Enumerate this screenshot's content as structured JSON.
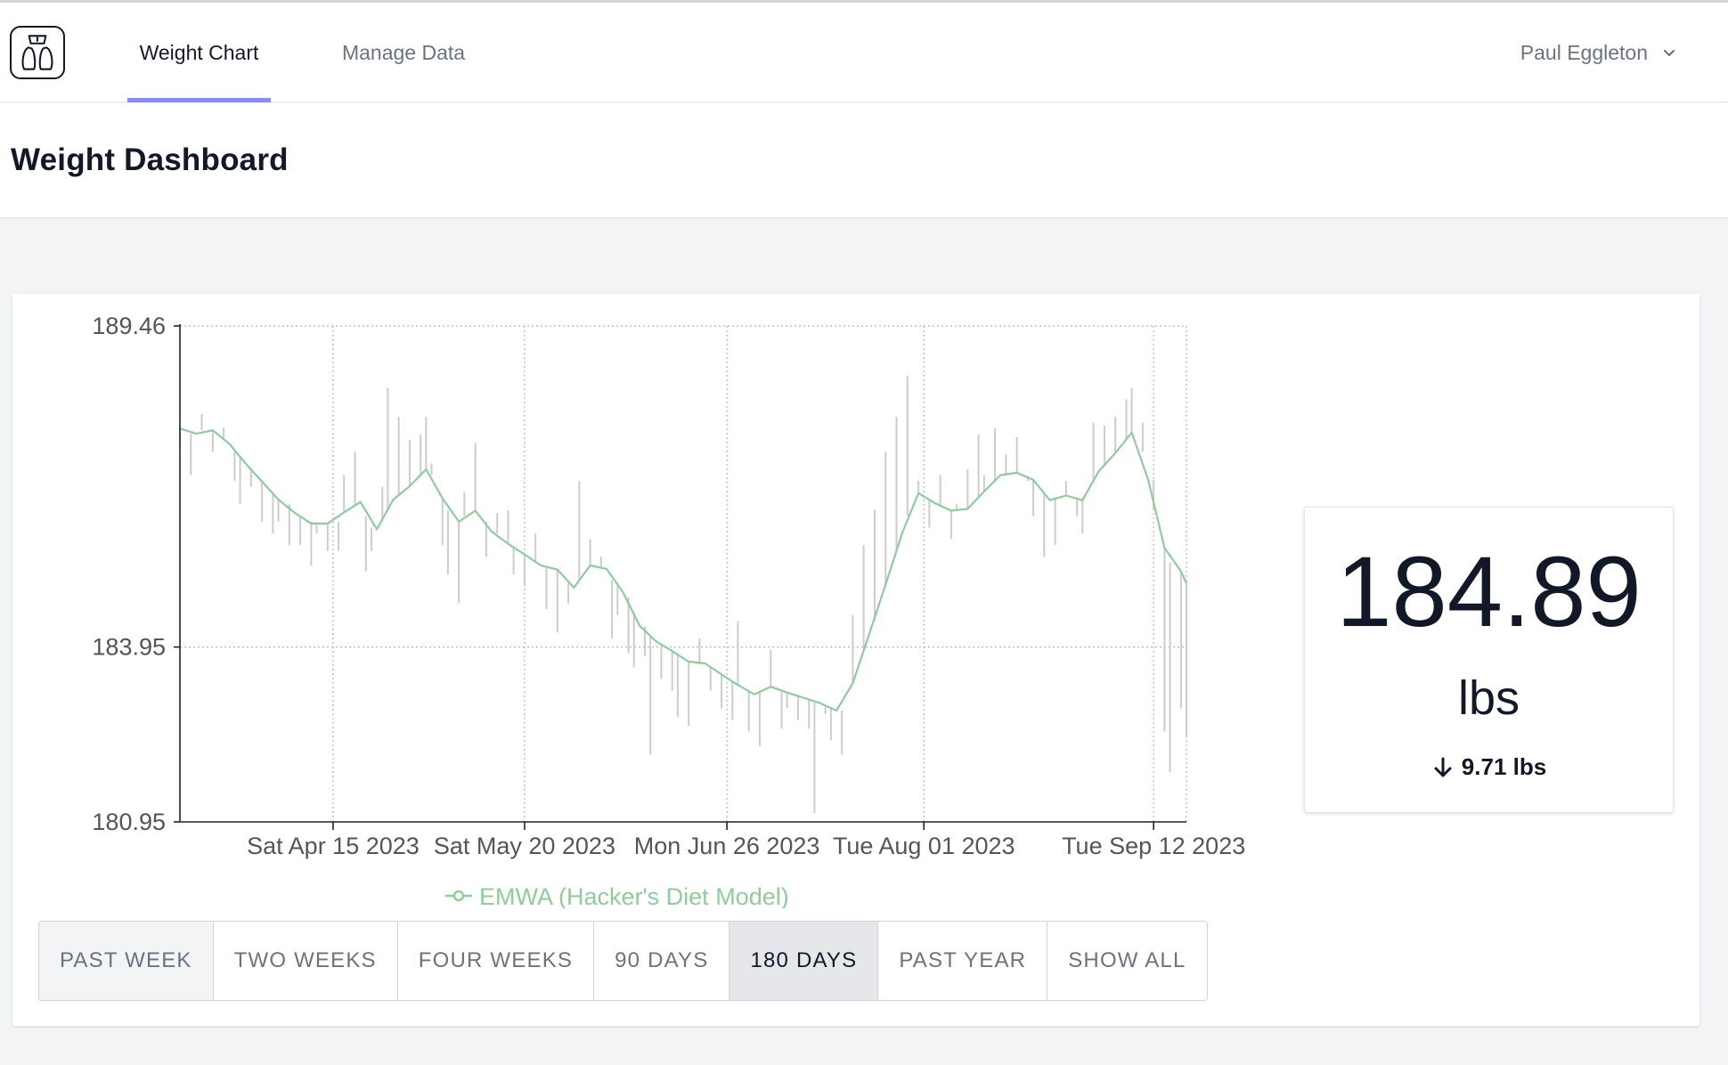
{
  "nav": {
    "tabs": [
      {
        "label": "Weight Chart",
        "active": true
      },
      {
        "label": "Manage Data",
        "active": false
      }
    ],
    "user_name": "Paul Eggleton",
    "logo_icon": "scale-icon",
    "accent_color": "#818cf8"
  },
  "page": {
    "title": "Weight Dashboard"
  },
  "stat": {
    "value": "184.89",
    "unit": "lbs",
    "change": "9.71 lbs",
    "change_direction": "down"
  },
  "ranges": {
    "buttons": [
      "PAST WEEK",
      "TWO WEEKS",
      "FOUR WEEKS",
      "90 DAYS",
      "180 DAYS",
      "PAST YEAR",
      "SHOW ALL"
    ],
    "selected": "180 DAYS"
  },
  "chart_data": {
    "type": "line",
    "ylim": [
      180.95,
      189.46
    ],
    "yticks": [
      "189.46",
      "183.95",
      "180.95"
    ],
    "x_start_date": "2023-03-18",
    "x_end_date": "2023-09-12",
    "xticks": [
      {
        "date": "2023-04-15",
        "label": "Sat Apr 15 2023"
      },
      {
        "date": "2023-05-20",
        "label": "Sat May 20 2023"
      },
      {
        "date": "2023-06-26",
        "label": "Mon Jun 26 2023"
      },
      {
        "date": "2023-08-01",
        "label": "Tue Aug 01 2023"
      },
      {
        "date": "2023-09-12",
        "label": "Tue Sep 12 2023"
      }
    ],
    "grid": true,
    "legend": "bottom-center",
    "series": [
      {
        "name": "EMWA (Hacker's Diet Model)",
        "color": "#8fcc9c",
        "points": [
          [
            "2023-03-18",
            187.7
          ],
          [
            "2023-03-21",
            187.61
          ],
          [
            "2023-03-24",
            187.67
          ],
          [
            "2023-03-27",
            187.44
          ],
          [
            "2023-03-30",
            187.1
          ],
          [
            "2023-04-02",
            186.79
          ],
          [
            "2023-04-05",
            186.48
          ],
          [
            "2023-04-08",
            186.25
          ],
          [
            "2023-04-11",
            186.07
          ],
          [
            "2023-04-14",
            186.07
          ],
          [
            "2023-04-17",
            186.26
          ],
          [
            "2023-04-20",
            186.44
          ],
          [
            "2023-04-23",
            185.97
          ],
          [
            "2023-04-26",
            186.48
          ],
          [
            "2023-04-29",
            186.71
          ],
          [
            "2023-05-02",
            187.0
          ],
          [
            "2023-05-05",
            186.5
          ],
          [
            "2023-05-08",
            186.1
          ],
          [
            "2023-05-11",
            186.29
          ],
          [
            "2023-05-14",
            185.93
          ],
          [
            "2023-05-17",
            185.72
          ],
          [
            "2023-05-20",
            185.54
          ],
          [
            "2023-05-23",
            185.35
          ],
          [
            "2023-05-26",
            185.28
          ],
          [
            "2023-05-29",
            184.97
          ],
          [
            "2023-06-01",
            185.35
          ],
          [
            "2023-06-04",
            185.29
          ],
          [
            "2023-06-07",
            184.89
          ],
          [
            "2023-06-10",
            184.32
          ],
          [
            "2023-06-13",
            184.05
          ],
          [
            "2023-06-16",
            183.88
          ],
          [
            "2023-06-19",
            183.7
          ],
          [
            "2023-06-22",
            183.67
          ],
          [
            "2023-06-25",
            183.48
          ],
          [
            "2023-06-28",
            183.3
          ],
          [
            "2023-07-01",
            183.14
          ],
          [
            "2023-07-04",
            183.27
          ],
          [
            "2023-07-07",
            183.17
          ],
          [
            "2023-07-10",
            183.08
          ],
          [
            "2023-07-13",
            182.99
          ],
          [
            "2023-07-16",
            182.86
          ],
          [
            "2023-07-19",
            183.33
          ],
          [
            "2023-07-22",
            184.17
          ],
          [
            "2023-07-25",
            185.02
          ],
          [
            "2023-07-28",
            185.9
          ],
          [
            "2023-07-31",
            186.59
          ],
          [
            "2023-08-03",
            186.42
          ],
          [
            "2023-08-06",
            186.29
          ],
          [
            "2023-08-09",
            186.32
          ],
          [
            "2023-08-12",
            186.62
          ],
          [
            "2023-08-15",
            186.9
          ],
          [
            "2023-08-18",
            186.94
          ],
          [
            "2023-08-21",
            186.82
          ],
          [
            "2023-08-24",
            186.47
          ],
          [
            "2023-08-27",
            186.55
          ],
          [
            "2023-08-30",
            186.47
          ],
          [
            "2023-09-02",
            186.97
          ],
          [
            "2023-09-05",
            187.28
          ],
          [
            "2023-09-08",
            187.63
          ],
          [
            "2023-09-11",
            186.82
          ],
          [
            "2023-09-14",
            185.65
          ],
          [
            "2023-09-17",
            185.25
          ],
          [
            "2023-09-18",
            185.04
          ]
        ]
      }
    ],
    "readings": {
      "color": "#cccccc",
      "description": "daily weight deviation bars from trend",
      "bars": [
        [
          "2023-03-18",
          187.7,
          187.4
        ],
        [
          "2023-03-20",
          187.61,
          186.9
        ],
        [
          "2023-03-22",
          187.67,
          187.95
        ],
        [
          "2023-03-24",
          187.65,
          187.3
        ],
        [
          "2023-03-26",
          187.55,
          187.72
        ],
        [
          "2023-03-28",
          187.3,
          186.8
        ],
        [
          "2023-03-29",
          187.2,
          186.4
        ],
        [
          "2023-03-31",
          187.0,
          186.7
        ],
        [
          "2023-04-02",
          186.8,
          186.1
        ],
        [
          "2023-04-04",
          186.6,
          185.9
        ],
        [
          "2023-04-05",
          186.5,
          186.1
        ],
        [
          "2023-04-07",
          186.4,
          185.7
        ],
        [
          "2023-04-09",
          186.2,
          185.7
        ],
        [
          "2023-04-11",
          186.1,
          185.35
        ],
        [
          "2023-04-12",
          186.05,
          185.9
        ],
        [
          "2023-04-14",
          186.07,
          185.6
        ],
        [
          "2023-04-16",
          186.1,
          185.6
        ],
        [
          "2023-04-17",
          186.26,
          186.9
        ],
        [
          "2023-04-19",
          186.4,
          187.3
        ],
        [
          "2023-04-21",
          186.2,
          185.25
        ],
        [
          "2023-04-22",
          186.0,
          185.6
        ],
        [
          "2023-04-24",
          186.1,
          186.7
        ],
        [
          "2023-04-25",
          186.3,
          188.4
        ],
        [
          "2023-04-27",
          186.55,
          187.9
        ],
        [
          "2023-04-29",
          186.71,
          187.5
        ],
        [
          "2023-05-01",
          186.9,
          187.6
        ],
        [
          "2023-05-02",
          187.0,
          187.9
        ],
        [
          "2023-05-03",
          186.9,
          187.1
        ],
        [
          "2023-05-05",
          186.5,
          185.7
        ],
        [
          "2023-05-06",
          186.3,
          185.2
        ],
        [
          "2023-05-08",
          186.1,
          184.7
        ],
        [
          "2023-05-09",
          186.2,
          186.6
        ],
        [
          "2023-05-11",
          186.29,
          187.45
        ],
        [
          "2023-05-13",
          186.1,
          185.5
        ],
        [
          "2023-05-15",
          185.9,
          186.25
        ],
        [
          "2023-05-17",
          185.72,
          186.3
        ],
        [
          "2023-05-18",
          185.65,
          185.2
        ],
        [
          "2023-05-20",
          185.54,
          185.0
        ],
        [
          "2023-05-22",
          185.4,
          185.9
        ],
        [
          "2023-05-24",
          185.33,
          184.6
        ],
        [
          "2023-05-26",
          185.28,
          184.2
        ],
        [
          "2023-05-28",
          185.05,
          184.7
        ],
        [
          "2023-05-30",
          185.1,
          186.8
        ],
        [
          "2023-06-01",
          185.35,
          185.8
        ],
        [
          "2023-06-03",
          185.3,
          185.5
        ],
        [
          "2023-06-05",
          185.1,
          184.1
        ],
        [
          "2023-06-06",
          185.0,
          184.5
        ],
        [
          "2023-06-08",
          184.8,
          183.85
        ],
        [
          "2023-06-09",
          184.55,
          183.6
        ],
        [
          "2023-06-11",
          184.3,
          183.8
        ],
        [
          "2023-06-12",
          184.15,
          182.1
        ],
        [
          "2023-06-14",
          184.0,
          183.4
        ],
        [
          "2023-06-16",
          183.88,
          183.2
        ],
        [
          "2023-06-17",
          183.8,
          182.75
        ],
        [
          "2023-06-19",
          183.7,
          182.6
        ],
        [
          "2023-06-21",
          183.65,
          184.1
        ],
        [
          "2023-06-23",
          183.6,
          183.2
        ],
        [
          "2023-06-25",
          183.48,
          182.9
        ],
        [
          "2023-06-27",
          183.35,
          182.7
        ],
        [
          "2023-06-28",
          183.3,
          184.4
        ],
        [
          "2023-06-30",
          183.2,
          182.5
        ],
        [
          "2023-07-02",
          183.18,
          182.25
        ],
        [
          "2023-07-04",
          183.27,
          183.9
        ],
        [
          "2023-07-06",
          183.2,
          182.55
        ],
        [
          "2023-07-07",
          183.17,
          182.9
        ],
        [
          "2023-07-09",
          183.1,
          182.7
        ],
        [
          "2023-07-11",
          183.05,
          182.55
        ],
        [
          "2023-07-12",
          183.0,
          181.1
        ],
        [
          "2023-07-14",
          182.95,
          182.8
        ],
        [
          "2023-07-15",
          182.9,
          182.35
        ],
        [
          "2023-07-17",
          182.86,
          182.1
        ],
        [
          "2023-07-19",
          183.33,
          184.5
        ],
        [
          "2023-07-21",
          183.9,
          185.7
        ],
        [
          "2023-07-23",
          184.4,
          186.3
        ],
        [
          "2023-07-25",
          185.02,
          187.3
        ],
        [
          "2023-07-27",
          185.6,
          187.9
        ],
        [
          "2023-07-29",
          186.2,
          188.6
        ],
        [
          "2023-07-31",
          186.59,
          186.8
        ],
        [
          "2023-08-02",
          186.48,
          186.0
        ],
        [
          "2023-08-04",
          186.38,
          186.9
        ],
        [
          "2023-08-06",
          186.29,
          185.8
        ],
        [
          "2023-08-07",
          186.3,
          186.4
        ],
        [
          "2023-08-09",
          186.32,
          187.0
        ],
        [
          "2023-08-11",
          186.5,
          187.6
        ],
        [
          "2023-08-12",
          186.62,
          186.9
        ],
        [
          "2023-08-14",
          186.8,
          187.7
        ],
        [
          "2023-08-16",
          186.92,
          187.25
        ],
        [
          "2023-08-18",
          186.94,
          187.55
        ],
        [
          "2023-08-20",
          186.88,
          186.8
        ],
        [
          "2023-08-21",
          186.82,
          186.2
        ],
        [
          "2023-08-23",
          186.6,
          185.5
        ],
        [
          "2023-08-25",
          186.48,
          185.7
        ],
        [
          "2023-08-27",
          186.55,
          186.8
        ],
        [
          "2023-08-29",
          186.5,
          186.2
        ],
        [
          "2023-08-30",
          186.47,
          185.9
        ],
        [
          "2023-09-01",
          186.8,
          187.8
        ],
        [
          "2023-09-03",
          187.05,
          187.75
        ],
        [
          "2023-09-05",
          187.28,
          187.9
        ],
        [
          "2023-09-07",
          187.5,
          188.2
        ],
        [
          "2023-09-08",
          187.63,
          188.4
        ],
        [
          "2023-09-10",
          187.3,
          187.8
        ],
        [
          "2023-09-12",
          186.82,
          186.3
        ],
        [
          "2023-09-14",
          185.65,
          182.5
        ],
        [
          "2023-09-15",
          185.4,
          181.8
        ],
        [
          "2023-09-17",
          185.25,
          182.9
        ],
        [
          "2023-09-18",
          185.04,
          182.4
        ]
      ]
    }
  }
}
